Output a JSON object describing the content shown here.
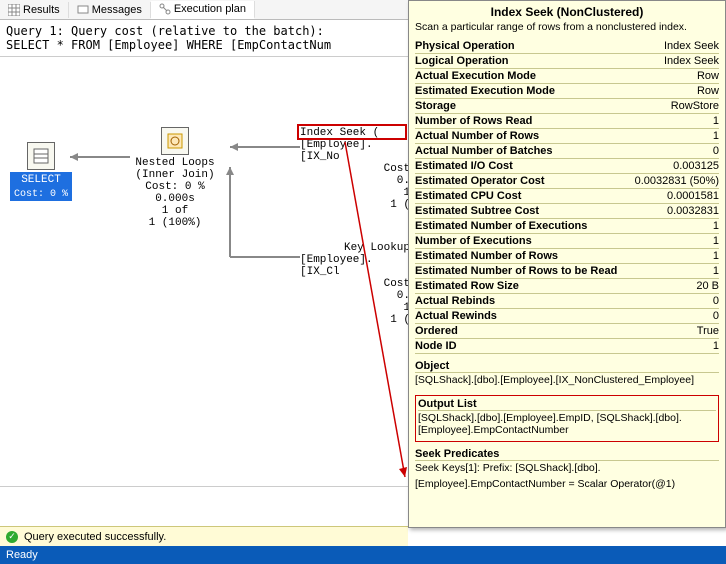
{
  "tabs": {
    "results": "Results",
    "messages": "Messages",
    "execplan": "Execution plan"
  },
  "query": {
    "line1": "Query 1: Query cost (relative to the batch):",
    "line2": "SELECT * FROM [Employee] WHERE [EmpContactNum"
  },
  "nodes": {
    "select": {
      "label": "SELECT",
      "cost": "Cost: 0 %"
    },
    "nested": {
      "l1": "Nested Loops",
      "l2": "(Inner Join)",
      "l3": "Cost: 0 %",
      "l4": "0.000s",
      "l5": "1 of",
      "l6": "1 (100%)"
    },
    "idxseek": {
      "l1": "Index Seek (",
      "l2": "[Employee].[IX_No",
      "l3": "Cost",
      "l4": "0.",
      "l5": "1 ",
      "l6": "1 ("
    },
    "keylook": {
      "l1": "Key Lookup",
      "l2": "[Employee].[IX_Cl",
      "l3": "Cost",
      "l4": "0.",
      "l5": "1 ",
      "l6": "1 ("
    }
  },
  "tooltip": {
    "title": "Index Seek (NonClustered)",
    "desc": "Scan a particular range of rows from a nonclustered index.",
    "rows": [
      {
        "k": "Physical Operation",
        "v": "Index Seek"
      },
      {
        "k": "Logical Operation",
        "v": "Index Seek"
      },
      {
        "k": "Actual Execution Mode",
        "v": "Row"
      },
      {
        "k": "Estimated Execution Mode",
        "v": "Row"
      },
      {
        "k": "Storage",
        "v": "RowStore"
      },
      {
        "k": "Number of Rows Read",
        "v": "1"
      },
      {
        "k": "Actual Number of Rows",
        "v": "1"
      },
      {
        "k": "Actual Number of Batches",
        "v": "0"
      },
      {
        "k": "Estimated I/O Cost",
        "v": "0.003125"
      },
      {
        "k": "Estimated Operator Cost",
        "v": "0.0032831 (50%)"
      },
      {
        "k": "Estimated CPU Cost",
        "v": "0.0001581"
      },
      {
        "k": "Estimated Subtree Cost",
        "v": "0.0032831"
      },
      {
        "k": "Estimated Number of Executions",
        "v": "1"
      },
      {
        "k": "Number of Executions",
        "v": "1"
      },
      {
        "k": "Estimated Number of Rows",
        "v": "1"
      },
      {
        "k": "Estimated Number of Rows to be Read",
        "v": "1"
      },
      {
        "k": "Estimated Row Size",
        "v": "20 B"
      },
      {
        "k": "Actual Rebinds",
        "v": "0"
      },
      {
        "k": "Actual Rewinds",
        "v": "0"
      },
      {
        "k": "Ordered",
        "v": "True"
      },
      {
        "k": "Node ID",
        "v": "1"
      }
    ],
    "object": {
      "hdr": "Object",
      "body": "[SQLShack].[dbo].[Employee].[IX_NonClustered_Employee]"
    },
    "output": {
      "hdr": "Output List",
      "body": "[SQLShack].[dbo].[Employee].EmpID, [SQLShack].[dbo].[Employee].EmpContactNumber"
    },
    "seek": {
      "hdr": "Seek Predicates",
      "body1": "Seek Keys[1]: Prefix: [SQLShack].[dbo].",
      "body2": "[Employee].EmpContactNumber = Scalar Operator(@1)"
    }
  },
  "status": {
    "msg": "Query executed successfully."
  },
  "ready": "Ready"
}
